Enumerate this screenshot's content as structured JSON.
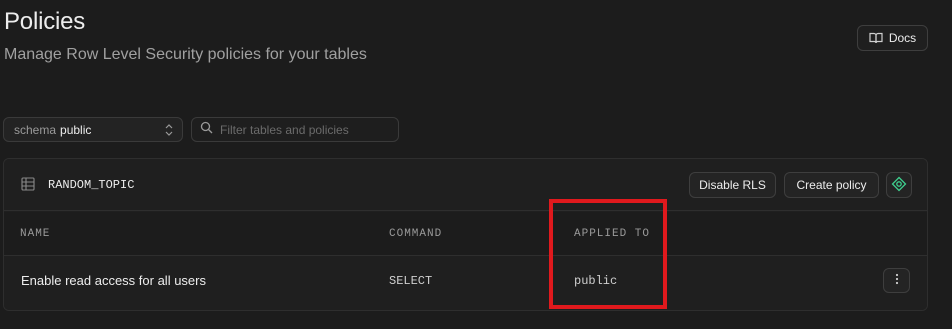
{
  "header": {
    "title": "Policies",
    "subtitle": "Manage Row Level Security policies for your tables",
    "docs_label": "Docs"
  },
  "filters": {
    "schema_prefix": "schema",
    "schema_value": "public",
    "search_placeholder": "Filter tables and policies"
  },
  "table_card": {
    "table_name": "RANDOM_TOPIC",
    "disable_rls_label": "Disable RLS",
    "create_policy_label": "Create policy",
    "columns": [
      "NAME",
      "COMMAND",
      "APPLIED TO"
    ],
    "rows": [
      {
        "name": "Enable read access for all users",
        "command": "SELECT",
        "applied_to": "public"
      }
    ]
  },
  "annotation": {
    "color": "#e0191d"
  }
}
